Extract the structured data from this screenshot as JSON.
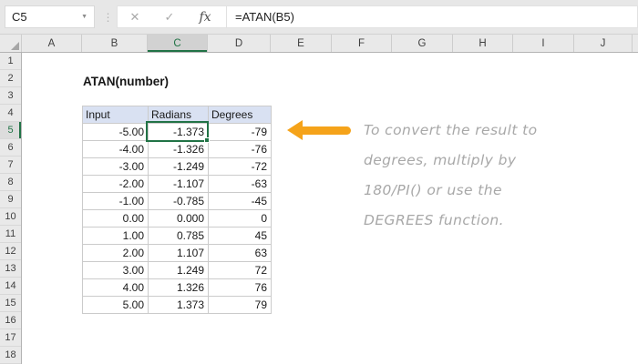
{
  "toolbar": {
    "name_box_value": "C5",
    "dropdown_icon": "▼",
    "separator_dots_icon": "⋮",
    "cancel_icon": "✕",
    "confirm_icon": "✓",
    "insert_function_icon": "fx",
    "formula": "=ATAN(B5)"
  },
  "grid": {
    "column_headers": [
      "A",
      "B",
      "C",
      "D",
      "E",
      "F",
      "G",
      "H",
      "I",
      "J"
    ],
    "selected_column": "C",
    "row_headers": [
      "1",
      "2",
      "3",
      "4",
      "5",
      "6",
      "7",
      "8",
      "9",
      "10",
      "11",
      "12",
      "13",
      "14",
      "15",
      "16",
      "17",
      "18"
    ],
    "selected_row": "5",
    "active_cell": "C5"
  },
  "sheet": {
    "title_cell": "ATAN(number)",
    "table": {
      "headers": [
        "Input",
        "Radians",
        "Degrees"
      ],
      "rows": [
        [
          "-5.00",
          "-1.373",
          "-79"
        ],
        [
          "-4.00",
          "-1.326",
          "-76"
        ],
        [
          "-3.00",
          "-1.249",
          "-72"
        ],
        [
          "-2.00",
          "-1.107",
          "-63"
        ],
        [
          "-1.00",
          "-0.785",
          "-45"
        ],
        [
          "0.00",
          "0.000",
          "0"
        ],
        [
          "1.00",
          "0.785",
          "45"
        ],
        [
          "2.00",
          "1.107",
          "63"
        ],
        [
          "3.00",
          "1.249",
          "72"
        ],
        [
          "4.00",
          "1.326",
          "76"
        ],
        [
          "5.00",
          "1.373",
          "79"
        ]
      ]
    }
  },
  "annotation": {
    "note_lines": [
      "To convert the result to",
      "degrees, multiply by",
      "180/PI() or use the",
      "DEGREES function."
    ]
  },
  "colors": {
    "selection_green": "#217346",
    "table_header_fill": "#d9e1f2",
    "arrow_orange": "#f5a31a",
    "note_gray": "#a8a8a8",
    "header_strip_gray": "#e9e9e9"
  }
}
